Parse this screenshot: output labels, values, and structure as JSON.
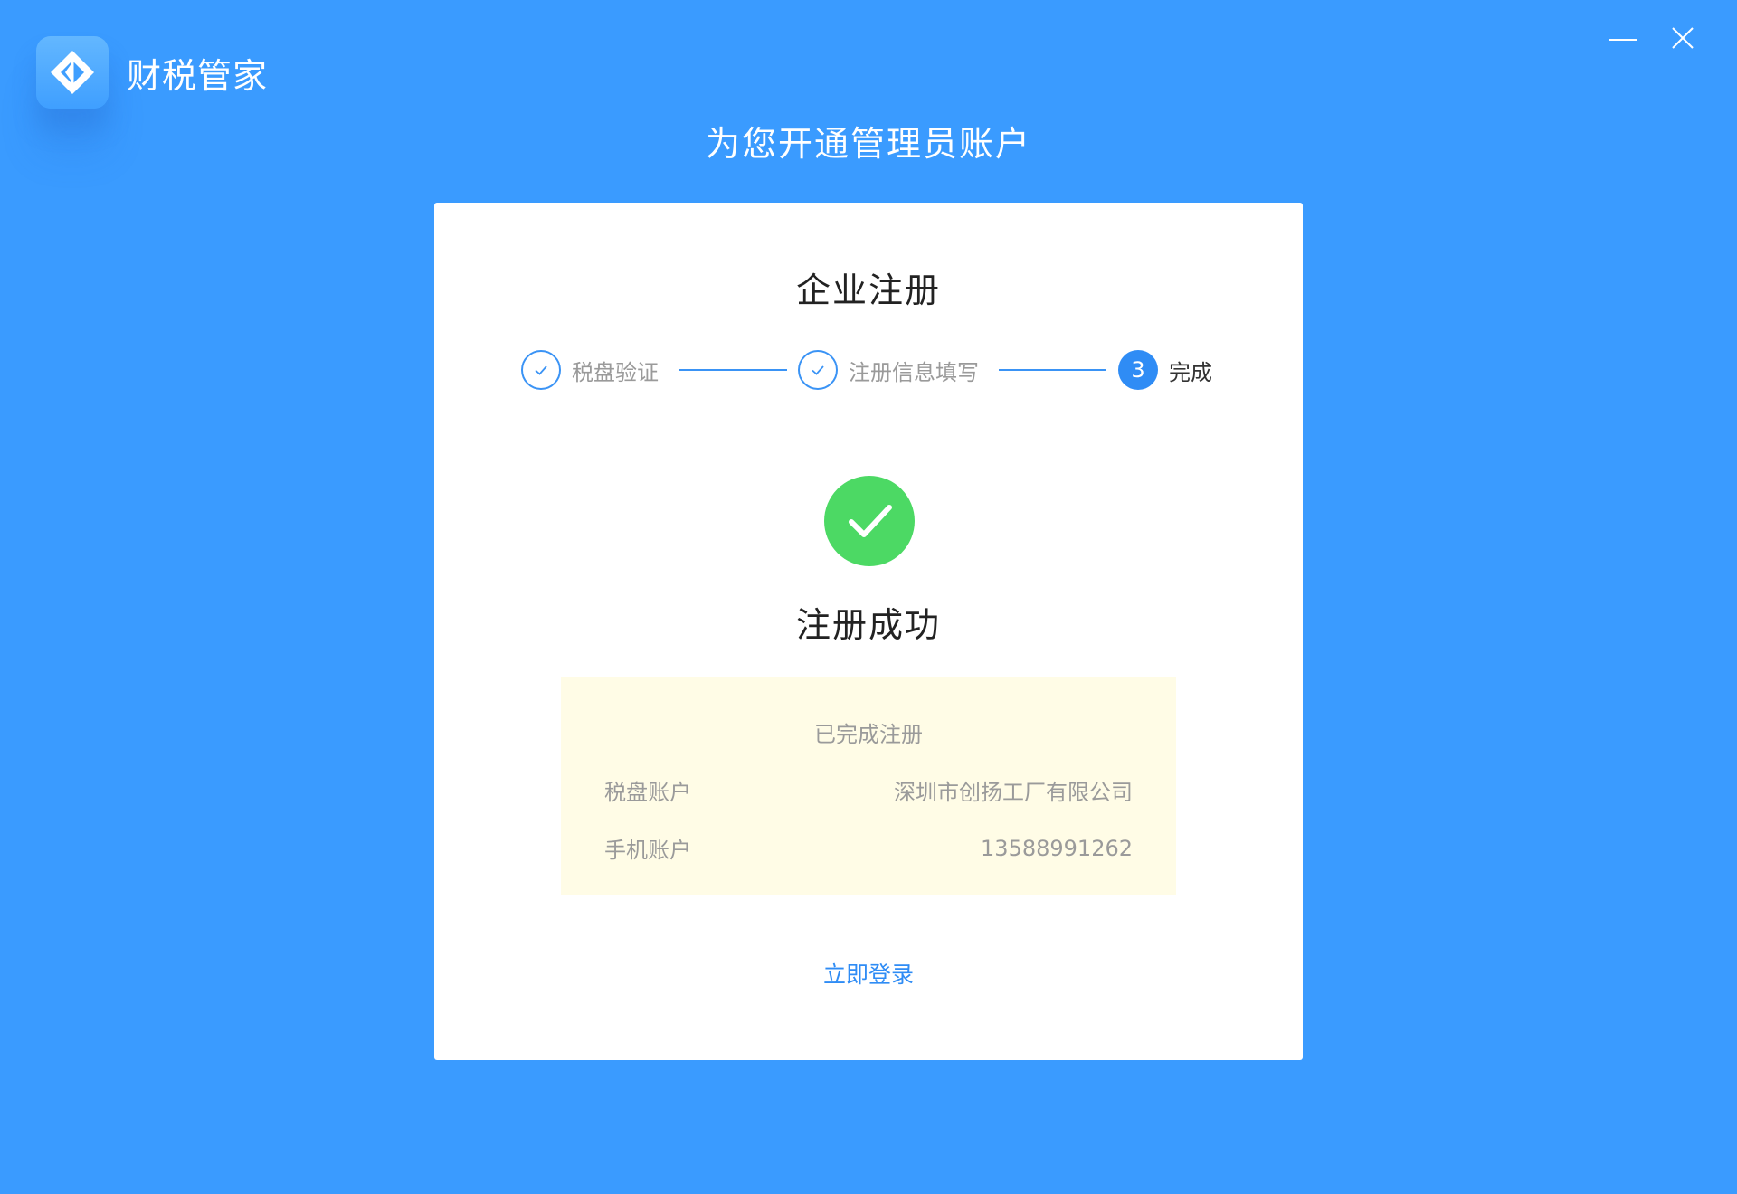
{
  "app": {
    "brand_name": "财税管家",
    "accent_color": "#3a9bff",
    "logo_icon": "diamond-logo-icon"
  },
  "window_controls": {
    "minimize_icon": "minimize-icon",
    "close_icon": "close-icon"
  },
  "page": {
    "heading": "为您开通管理员账户"
  },
  "card": {
    "title": "企业注册",
    "steps": [
      {
        "label": "税盘验证",
        "status": "done",
        "icon": "check-icon"
      },
      {
        "label": "注册信息填写",
        "status": "done",
        "icon": "check-icon"
      },
      {
        "label": "完成",
        "status": "active",
        "number": "3"
      }
    ],
    "success": {
      "icon": "success-check-icon",
      "title": "注册成功",
      "color": "#4cd964"
    },
    "info": {
      "heading": "已完成注册",
      "rows": [
        {
          "label": "税盘账户",
          "value": "深圳市创扬工厂有限公司"
        },
        {
          "label": "手机账户",
          "value": "13588991262"
        }
      ],
      "background": "#fffce6"
    },
    "login_link": "立即登录"
  }
}
